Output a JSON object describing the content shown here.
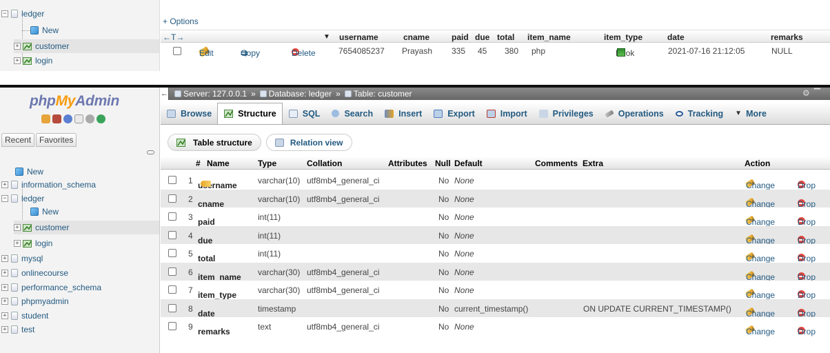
{
  "top_snippet": {
    "nav": [
      "ledger",
      "New",
      "customer",
      "login"
    ],
    "options_link": "+ Options",
    "columns": [
      "username",
      "cname",
      "paid",
      "due",
      "total",
      "item_name",
      "item_type",
      "date",
      "remarks"
    ],
    "sort_arrows": "←T→",
    "sort_icon": "▼",
    "row": {
      "edit": "Edit",
      "copy": "Copy",
      "delete": "Delete",
      "values": [
        "7654085237",
        "Prayash",
        "335",
        "45",
        "380",
        "php",
        "Book",
        "2021-07-16 21:12:05",
        "NULL"
      ]
    }
  },
  "nav": {
    "logo_php": "php",
    "logo_my": "My",
    "logo_admin": "Admin",
    "tabs": [
      "Recent",
      "Favorites"
    ],
    "tree": [
      {
        "label": "New",
        "type": "new",
        "level": 0
      },
      {
        "label": "information_schema",
        "type": "db",
        "level": 0
      },
      {
        "label": "ledger",
        "type": "db",
        "level": 0,
        "expanded": true
      },
      {
        "label": "New",
        "type": "new",
        "level": 1
      },
      {
        "label": "customer",
        "type": "table",
        "level": 1,
        "selected": true
      },
      {
        "label": "login",
        "type": "table",
        "level": 1
      },
      {
        "label": "mysql",
        "type": "db",
        "level": 0
      },
      {
        "label": "onlinecourse",
        "type": "db",
        "level": 0
      },
      {
        "label": "performance_schema",
        "type": "db",
        "level": 0
      },
      {
        "label": "phpmyadmin",
        "type": "db",
        "level": 0
      },
      {
        "label": "student",
        "type": "db",
        "level": 0
      },
      {
        "label": "test",
        "type": "db",
        "level": 0
      }
    ]
  },
  "breadcrumb": {
    "server": "Server: 127.0.0.1",
    "database": "Database: ledger",
    "table": "Table: customer",
    "sep": "»"
  },
  "tabs": [
    "Browse",
    "Structure",
    "SQL",
    "Search",
    "Insert",
    "Export",
    "Import",
    "Privileges",
    "Operations",
    "Tracking",
    "More"
  ],
  "more_prefix": "▼",
  "subtabs": [
    "Table structure",
    "Relation view"
  ],
  "structure_headers": [
    "#",
    "Name",
    "Type",
    "Collation",
    "Attributes",
    "Null",
    "Default",
    "Comments",
    "Extra",
    "Action"
  ],
  "structure_rows": [
    {
      "num": "1",
      "name": "username",
      "type": "varchar(10)",
      "collation": "utf8mb4_general_ci",
      "null": "No",
      "default": "None",
      "extra": "",
      "key": true
    },
    {
      "num": "2",
      "name": "cname",
      "type": "varchar(10)",
      "collation": "utf8mb4_general_ci",
      "null": "No",
      "default": "None",
      "extra": ""
    },
    {
      "num": "3",
      "name": "paid",
      "type": "int(11)",
      "collation": "",
      "null": "No",
      "default": "None",
      "extra": ""
    },
    {
      "num": "4",
      "name": "due",
      "type": "int(11)",
      "collation": "",
      "null": "No",
      "default": "None",
      "extra": ""
    },
    {
      "num": "5",
      "name": "total",
      "type": "int(11)",
      "collation": "",
      "null": "No",
      "default": "None",
      "extra": ""
    },
    {
      "num": "6",
      "name": "item_name",
      "type": "varchar(30)",
      "collation": "utf8mb4_general_ci",
      "null": "No",
      "default": "None",
      "extra": ""
    },
    {
      "num": "7",
      "name": "item_type",
      "type": "varchar(30)",
      "collation": "utf8mb4_general_ci",
      "null": "No",
      "default": "None",
      "extra": ""
    },
    {
      "num": "8",
      "name": "date",
      "type": "timestamp",
      "collation": "",
      "null": "No",
      "default": "current_timestamp()",
      "extra": "ON UPDATE CURRENT_TIMESTAMP()"
    },
    {
      "num": "9",
      "name": "remarks",
      "type": "text",
      "collation": "utf8mb4_general_ci",
      "null": "No",
      "default": "None",
      "extra": ""
    }
  ],
  "row_actions": {
    "change": "Change",
    "drop": "Drop"
  },
  "colors": {
    "link": "#235a81",
    "logo_blue": "#6c78af",
    "logo_orange": "#f89c0e",
    "delete_red": "#e0463e",
    "selected_row": "#e4e4e4"
  }
}
